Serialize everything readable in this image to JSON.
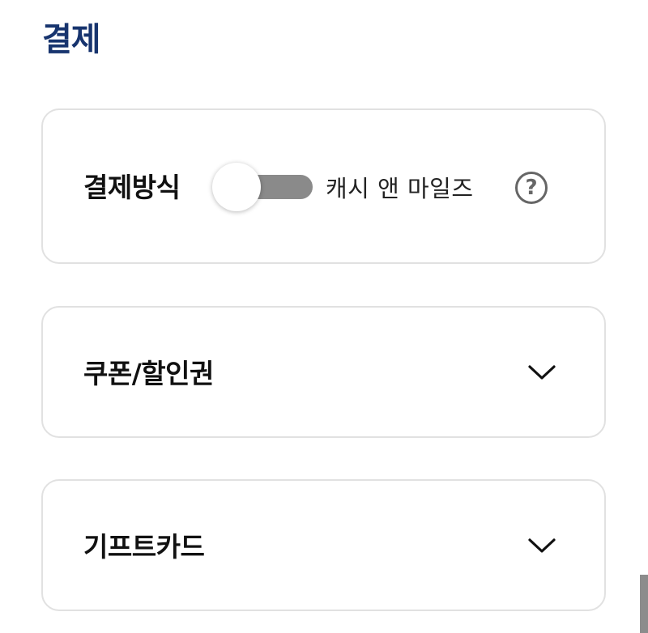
{
  "page": {
    "title": "결제"
  },
  "payment": {
    "label": "결제방식",
    "method_text": "캐시 앤 마일즈",
    "toggle_on": false,
    "help_symbol": "?"
  },
  "coupon": {
    "label": "쿠폰/할인권"
  },
  "giftcard": {
    "label": "기프트카드"
  },
  "icons": {
    "help": "question-circle-icon",
    "expand": "chevron-down-icon"
  },
  "colors": {
    "title": "#17346e",
    "toggle_track": "#8a8a8a",
    "card_border": "#e1e1e1"
  }
}
